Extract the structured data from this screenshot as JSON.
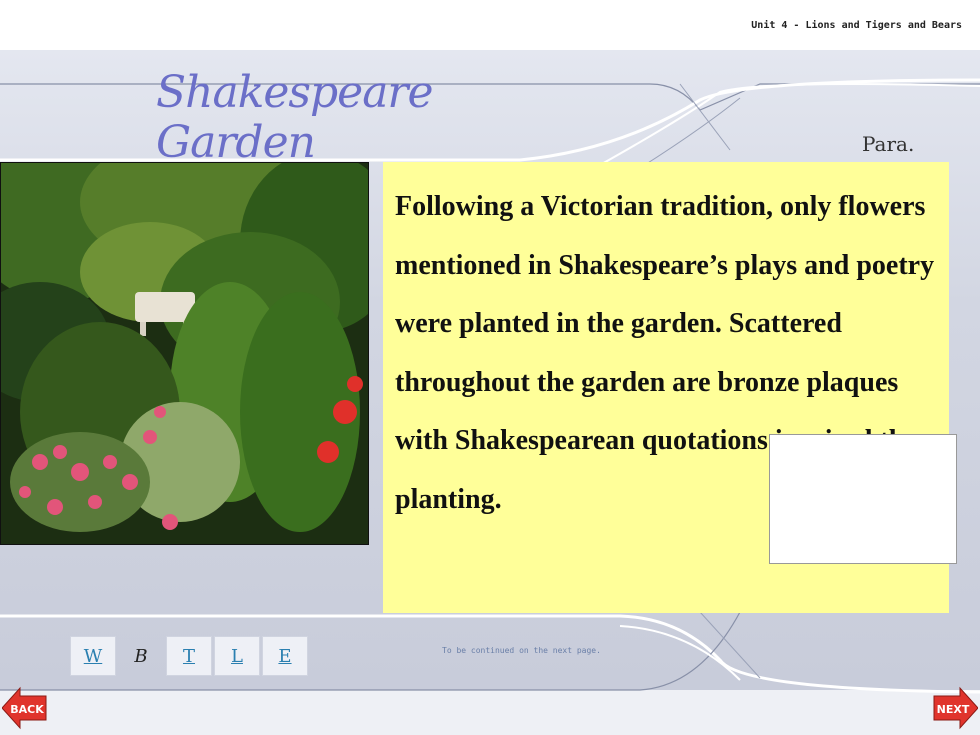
{
  "header": {
    "unit_title": "Unit 4 - Lions and Tigers and Bears"
  },
  "slide": {
    "title_line1": "Shakespeare",
    "title_line2": "Garden",
    "para_label": "Para.",
    "body_text": "Following a Victorian tradition, only flowers mentioned in Shakespeare’s plays and poetry were planted in the garden. Scattered throughout the garden are bronze plaques with Shakespearean quotations inspired the planting."
  },
  "nav": {
    "items": [
      {
        "label": "W"
      },
      {
        "label": "B"
      },
      {
        "label": "T"
      },
      {
        "label": "L"
      },
      {
        "label": "E"
      }
    ],
    "continued": "To be continued on the next page.",
    "back_label": "BACK",
    "next_label": "NEXT"
  },
  "colors": {
    "title": "#6b6fc8",
    "text_panel": "#ffff99",
    "arrow": "#e0342c",
    "nav_link": "#2a7fb0"
  }
}
